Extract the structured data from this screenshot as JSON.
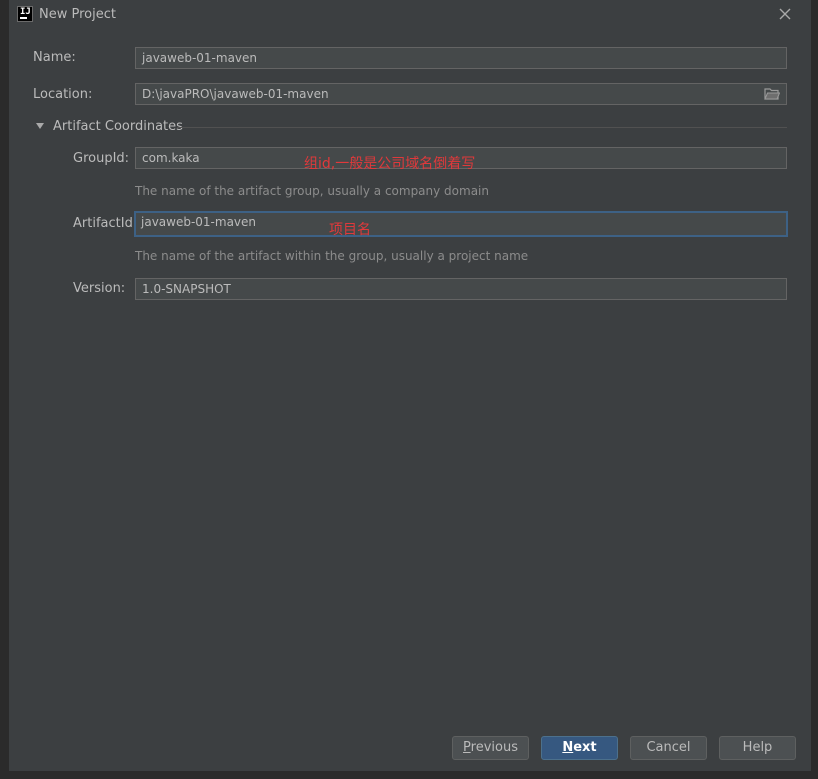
{
  "window": {
    "title": "New Project",
    "app_icon": "intellij-idea-icon",
    "close_icon": "close-icon"
  },
  "form": {
    "name_label": "Name:",
    "name_value": "javaweb-01-maven",
    "location_label": "Location:",
    "location_value": "D:\\javaPRO\\javaweb-01-maven",
    "location_browse_icon": "folder-icon"
  },
  "artifact_section": {
    "title": "Artifact Coordinates",
    "expanded": true,
    "groupid_label": "GroupId:",
    "groupid_value": "com.kaka",
    "groupid_hint": "The name of the artifact group, usually a company domain",
    "artifactid_label": "ArtifactId:",
    "artifactid_value": "javaweb-01-maven",
    "artifactid_hint": "The name of the artifact within the group, usually a project name",
    "version_label": "Version:",
    "version_value": "1.0-SNAPSHOT"
  },
  "annotations": {
    "groupid_note": "组id,一般是公司域名倒着写",
    "artifactid_note": "项目名"
  },
  "buttons": {
    "previous_mn": "P",
    "previous_rest": "revious",
    "next_mn": "N",
    "next_rest": "ext",
    "cancel": "Cancel",
    "help": "Help"
  },
  "colors": {
    "background": "#3c3f41",
    "field_bg": "#45494a",
    "focus_border": "#3d6185",
    "primary_button": "#365880",
    "annotation_red": "#e0393b"
  }
}
